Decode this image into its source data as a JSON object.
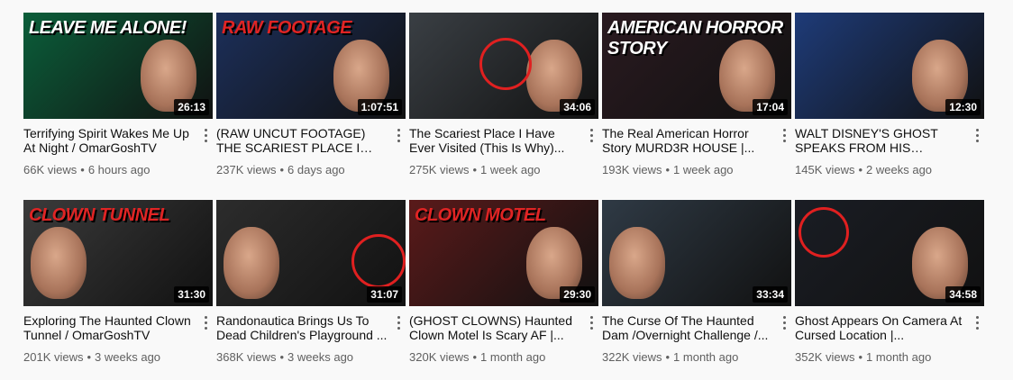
{
  "rows": [
    [
      {
        "title": "Terrifying Spirit Wakes Me Up At Night / OmarGoshTV",
        "views": "66K views",
        "age": "6 hours ago",
        "duration": "26:13",
        "overlay": "LEAVE ME ALONE!",
        "theme": "#0b5e3a",
        "overlay_color": "#ffffff"
      },
      {
        "title": "(RAW UNCUT FOOTAGE) THE SCARIEST PLACE I HAVE...",
        "views": "237K views",
        "age": "6 days ago",
        "duration": "1:07:51",
        "overlay": "RAW FOOTAGE",
        "theme": "#1c2f5a",
        "overlay_color": "#e02424"
      },
      {
        "title": "The Scariest Place I Have Ever Visited (This Is Why)...",
        "views": "275K views",
        "age": "1 week ago",
        "duration": "34:06",
        "overlay": "",
        "theme": "#3a3f44",
        "overlay_color": "#ffffff"
      },
      {
        "title": "The Real American Horror Story MURD3R HOUSE |...",
        "views": "193K views",
        "age": "1 week ago",
        "duration": "17:04",
        "overlay": "AMERICAN HORROR STORY",
        "theme": "#2a1a20",
        "overlay_color": "#ffffff"
      },
      {
        "title": "WALT DISNEY'S GHOST SPEAKS FROM HIS GRAVE...",
        "views": "145K views",
        "age": "2 weeks ago",
        "duration": "12:30",
        "overlay": "",
        "theme": "#1e3b78",
        "overlay_color": "#ffffff"
      }
    ],
    [
      {
        "title": "Exploring The Haunted Clown Tunnel / OmarGoshTV",
        "views": "201K views",
        "age": "3 weeks ago",
        "duration": "31:30",
        "overlay": "CLOWN TUNNEL",
        "theme": "#3b3b3b",
        "overlay_color": "#e02424"
      },
      {
        "title": "Randonautica Brings Us To Dead Children's Playground ...",
        "views": "368K views",
        "age": "3 weeks ago",
        "duration": "31:07",
        "overlay": "",
        "theme": "#2c2c2c",
        "overlay_color": "#ffffff"
      },
      {
        "title": "(GHOST CLOWNS) Haunted Clown Motel Is Scary AF |...",
        "views": "320K views",
        "age": "1 month ago",
        "duration": "29:30",
        "overlay": "CLOWN MOTEL",
        "theme": "#5a1a1a",
        "overlay_color": "#e02424"
      },
      {
        "title": "The Curse Of The Haunted Dam /Overnight Challenge /...",
        "views": "322K views",
        "age": "1 month ago",
        "duration": "33:34",
        "overlay": "",
        "theme": "#2f3a45",
        "overlay_color": "#ffffff"
      },
      {
        "title": "Ghost Appears On Camera At Cursed Location |...",
        "views": "352K views",
        "age": "1 month ago",
        "duration": "34:58",
        "overlay": "",
        "theme": "#1a1d24",
        "overlay_color": "#ffffff"
      }
    ]
  ]
}
